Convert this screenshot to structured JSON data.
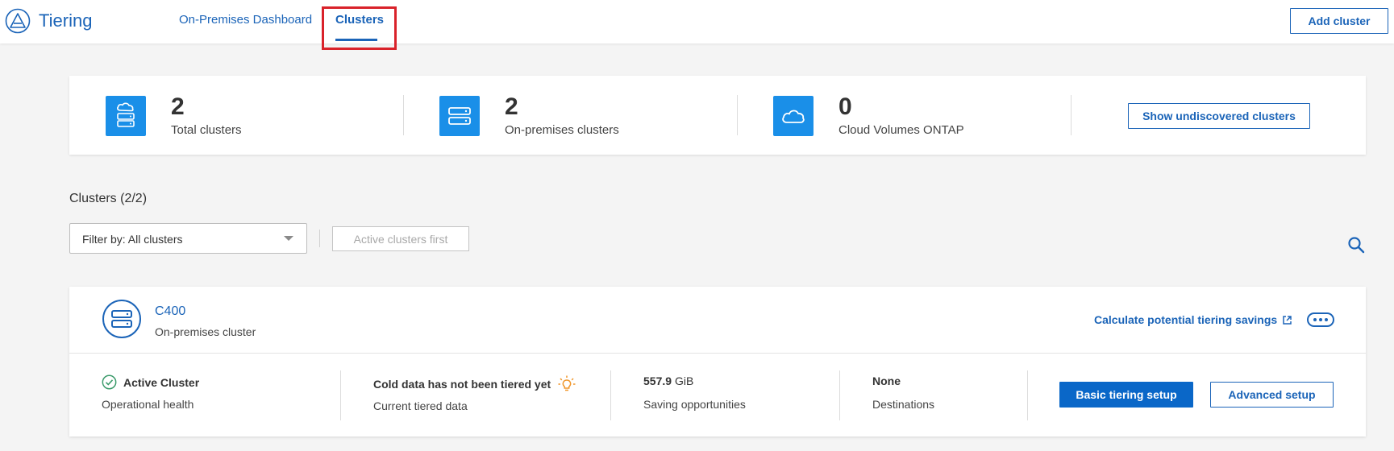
{
  "app": {
    "title": "Tiering"
  },
  "nav": {
    "tabs": [
      {
        "label": "On-Premises Dashboard"
      },
      {
        "label": "Clusters"
      }
    ],
    "add_cluster_label": "Add cluster"
  },
  "summary": {
    "items": [
      {
        "count": "2",
        "label": "Total clusters"
      },
      {
        "count": "2",
        "label": "On-premises clusters"
      },
      {
        "count": "0",
        "label": "Cloud Volumes ONTAP"
      }
    ],
    "show_undiscovered_label": "Show undiscovered clusters"
  },
  "clusters": {
    "section_title": "Clusters (2/2)",
    "filter_value": "Filter by: All clusters",
    "sort_label": "Active clusters first",
    "items": [
      {
        "name": "C400",
        "type": "On-premises cluster",
        "calc_link": "Calculate potential tiering savings",
        "health_value": "Active Cluster",
        "health_label": "Operational health",
        "tiered_value": "Cold data has not been tiered yet",
        "tiered_label": "Current tiered data",
        "saving_value": "557.9",
        "saving_unit": "GiB",
        "saving_label": "Saving opportunities",
        "dest_value": "None",
        "dest_label": "Destinations",
        "basic_setup_label": "Basic tiering setup",
        "advanced_setup_label": "Advanced setup"
      }
    ]
  },
  "colors": {
    "accent": "#1b64b8",
    "icon_blue": "#1a8fe8",
    "primary_button": "#0a67c8",
    "highlight": "#d9222a",
    "success": "#3a9a6a",
    "bulb": "#f0962a"
  },
  "icons": [
    "tiering-logo-icon",
    "cloud-server-icon",
    "server-icon",
    "cloud-icon",
    "search-icon",
    "check-circle-icon",
    "lightbulb-icon",
    "external-link-icon",
    "more-icon"
  ]
}
